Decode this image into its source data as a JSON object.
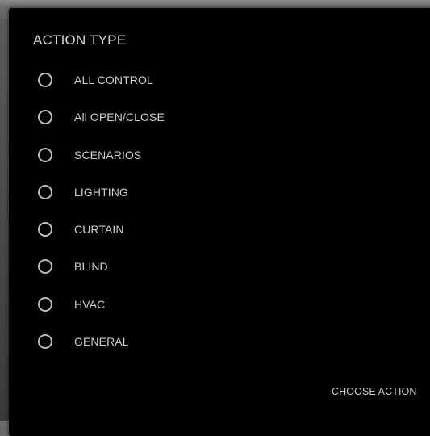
{
  "dialog": {
    "title": "ACTION TYPE",
    "options": [
      {
        "label": "ALL CONTROL",
        "selected": false
      },
      {
        "label": "All OPEN/CLOSE",
        "selected": false
      },
      {
        "label": "SCENARIOS",
        "selected": false
      },
      {
        "label": "LIGHTING",
        "selected": false
      },
      {
        "label": "CURTAIN",
        "selected": false
      },
      {
        "label": "BLIND",
        "selected": false
      },
      {
        "label": "HVAC",
        "selected": false
      },
      {
        "label": "GENERAL",
        "selected": false
      }
    ],
    "confirm_label": "CHOOSE ACTION"
  },
  "colors": {
    "dialog_background": "#000000",
    "text": "#cfcfcf",
    "radio_border": "#bdbdbd"
  }
}
